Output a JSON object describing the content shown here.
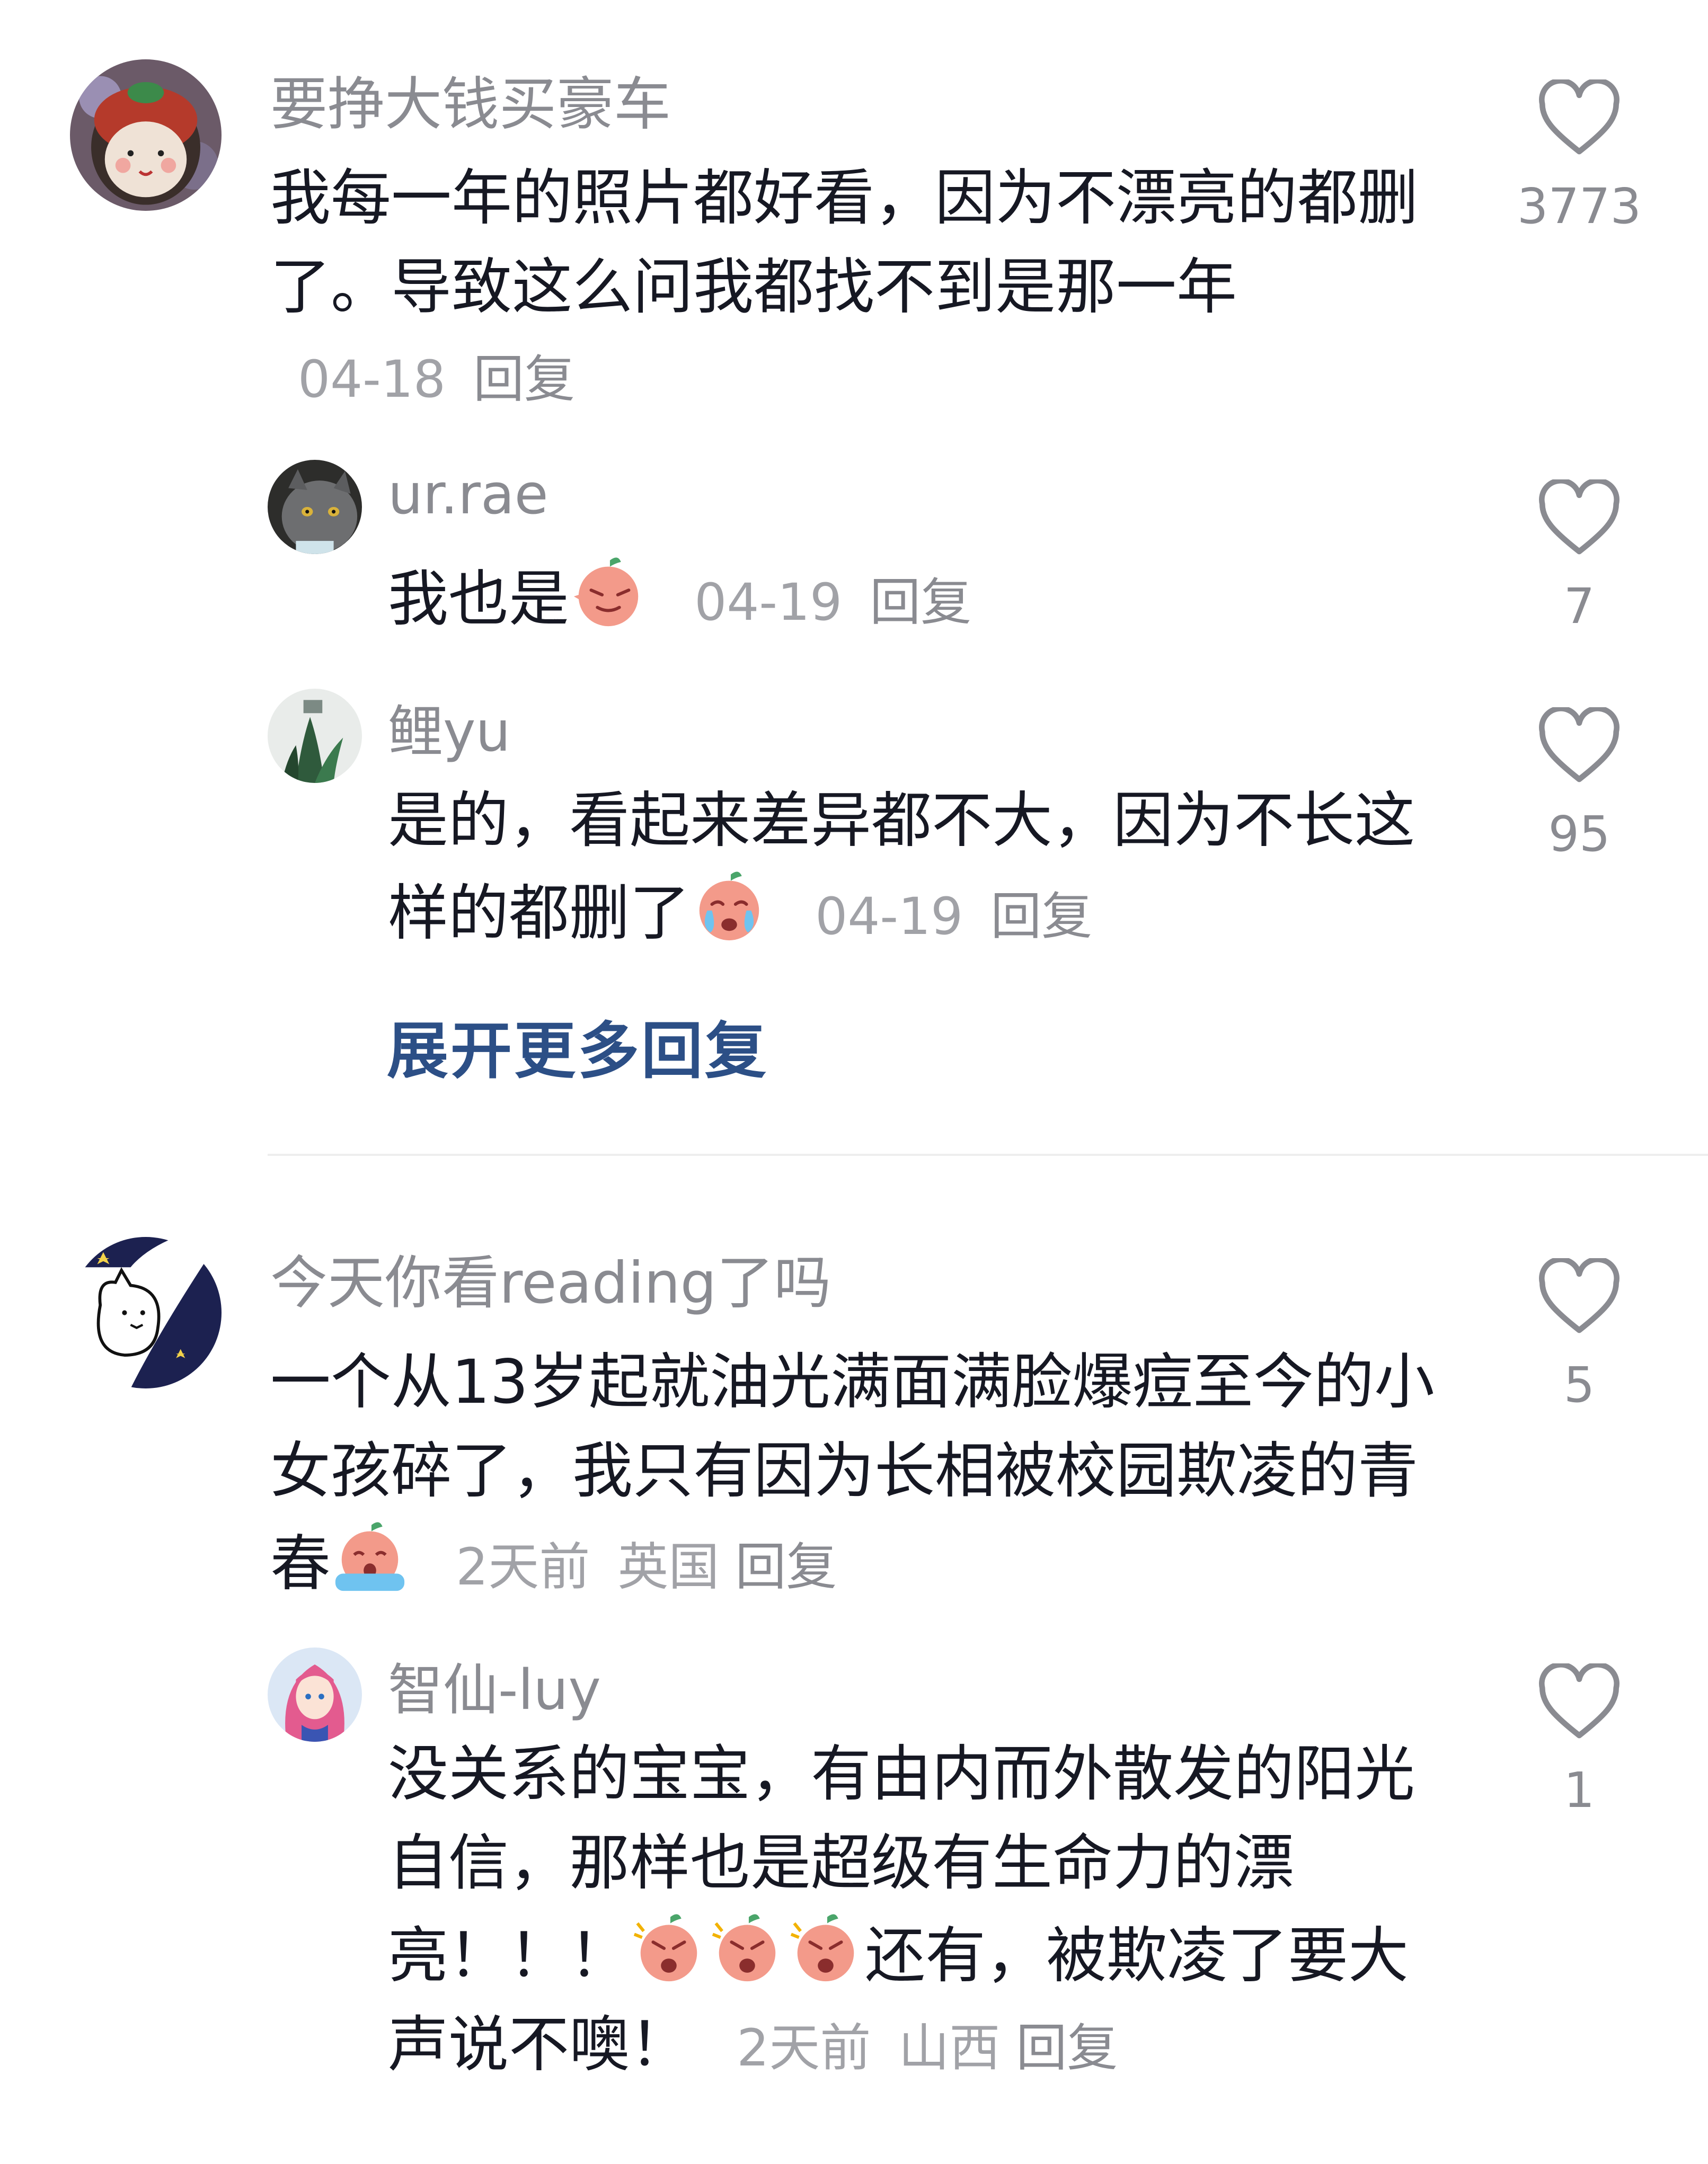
{
  "comments": [
    {
      "username": "要挣大钱买豪车",
      "text": "我每一年的照片都好看，因为不漂亮的都删了。导致这么问我都找不到是那一年",
      "time": "04-18",
      "location": "",
      "reply_label": "回复",
      "likes": "3773",
      "replies": [
        {
          "username": "ur.rae",
          "text": "我也是",
          "emoji_after": [
            "smirk-emoji"
          ],
          "time": "04-19",
          "reply_label": "回复",
          "likes": "7"
        },
        {
          "username": "鲤yu",
          "text": "是的，看起来差异都不大，因为不长这样的都删了",
          "emoji_after": [
            "crying-emoji"
          ],
          "time": "04-19",
          "reply_label": "回复",
          "likes": "95"
        }
      ],
      "expand_label": "展开更多回复"
    },
    {
      "username": "今天你看reading了吗",
      "text": "一个从13岁起就油光满面满脸爆痘至今的小女孩碎了，我只有因为长相被校园欺凌的青春",
      "time": "2天前",
      "location": "英国",
      "reply_label": "回复",
      "likes": "5",
      "replies": [
        {
          "username": "智仙-luy",
          "text_before": "没关系的宝宝，有由内而外散发的阳光自信，那样也是超级有生命力的漂亮！！！",
          "text_after": "还有，被欺凌了要大声说不噢！",
          "emoji_mid": [
            "angry-emoji",
            "angry-emoji",
            "angry-emoji"
          ],
          "time": "2天前",
          "location": "山西",
          "reply_label": "回复",
          "likes": "1"
        }
      ]
    }
  ]
}
